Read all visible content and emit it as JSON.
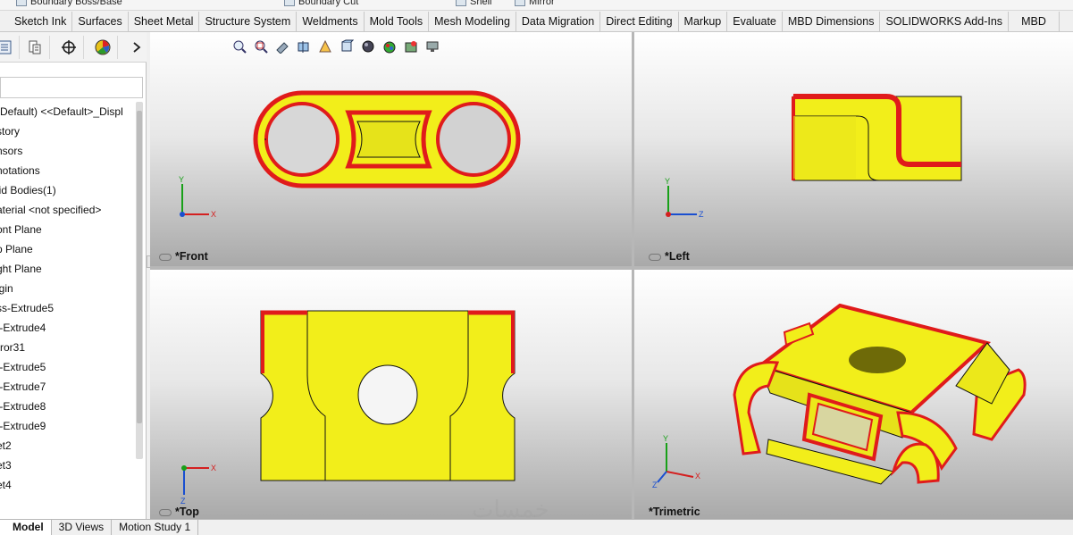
{
  "ribbon_top": {
    "items": [
      "Boundary Boss/Base",
      "Boundary Cut",
      "Shell",
      "Mirror"
    ]
  },
  "command_tabs": [
    "Sketch Ink",
    "Surfaces",
    "Sheet Metal",
    "Structure System",
    "Weldments",
    "Mold Tools",
    "Mesh Modeling",
    "Data Migration",
    "Direct Editing",
    "Markup",
    "Evaluate",
    "MBD Dimensions",
    "SOLIDWORKS Add-Ins",
    "MBD"
  ],
  "feature_manager": {
    "tabs_icons": [
      "feature-tree-icon",
      "property-manager-icon",
      "configuration-manager-icon",
      "appearance-manager-icon",
      "expand-arrow-icon"
    ],
    "tree": [
      "(Default) <<Default>_Displ",
      "story",
      "nsors",
      "notations",
      "lid Bodies(1)",
      "aterial <not specified>",
      "ont Plane",
      "p Plane",
      "ght Plane",
      "igin",
      "ss-Extrude5",
      "t-Extrude4",
      "rror31",
      "t-Extrude5",
      "t-Extrude7",
      "t-Extrude8",
      "t-Extrude9",
      "et2",
      "et3",
      "et4"
    ]
  },
  "viewports": {
    "front": "*Front",
    "left": "*Left",
    "top": "*Top",
    "trimetric": "*Trimetric"
  },
  "triad_axes": {
    "x": "X",
    "y": "Y",
    "z": "Z"
  },
  "bottom_tabs": [
    "Model",
    "3D Views",
    "Motion Study 1"
  ],
  "colors": {
    "part_yellow": "#f2ee1a",
    "edge_red": "#e01b1b",
    "axis_x": "#d42020",
    "axis_y": "#18a018",
    "axis_z": "#1a4fd0"
  },
  "watermark": "خمسات"
}
